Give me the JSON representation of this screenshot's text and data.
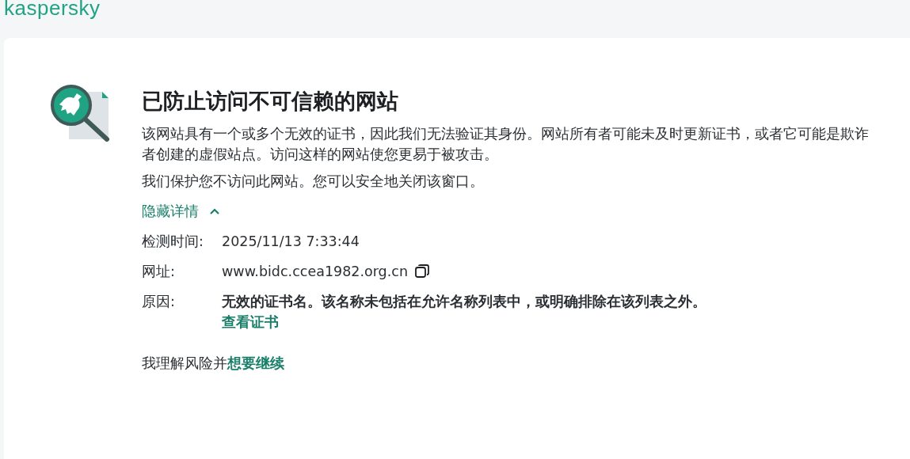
{
  "brand": "kaspersky",
  "title": "已防止访问不可信赖的网站",
  "paragraphs": [
    "该网站具有一个或多个无效的证书，因此我们无法验证其身份。网站所有者可能未及时更新证书，或者它可能是欺诈者创建的虚假站点。访问这样的网站使您更易于被攻击。",
    "我们保护您不访问此网站。您可以安全地关闭该窗口。"
  ],
  "details_toggle": {
    "label": "隐藏详情",
    "expanded": true
  },
  "details": [
    {
      "kind": "text",
      "label": "检测时间:",
      "value": "2025/11/13 7:33:44"
    },
    {
      "kind": "copy",
      "label": "网址:",
      "value": "www.bidc.ccea1982.org.cn"
    },
    {
      "kind": "reason",
      "label": "原因:",
      "value": "无效的证书名。该名称未包括在允许名称列表中，或明确排除在该列表之外。",
      "link": "查看证书"
    }
  ],
  "proceed": {
    "text": "我理解风险并",
    "link": "想要继续"
  }
}
